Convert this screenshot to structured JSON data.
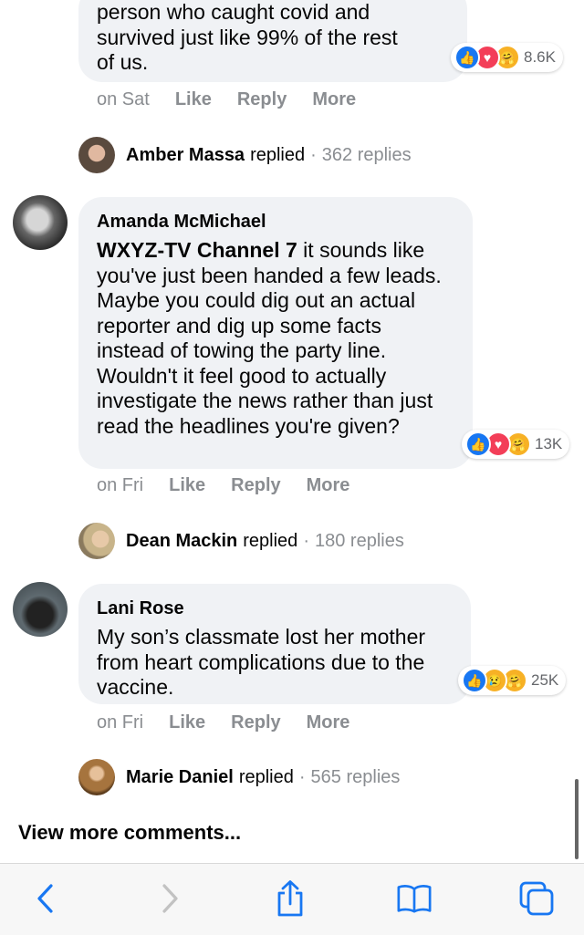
{
  "comments": [
    {
      "author": "",
      "text_lines": [
        "person who caught covid and",
        "survived just like 99% of the rest",
        "of us."
      ],
      "reaction_count": "8.6K",
      "time": "on Sat",
      "actions": [
        "Like",
        "Reply",
        "More"
      ],
      "replies": {
        "name": "Amber Massa",
        "verb": "replied",
        "count": "362 replies"
      }
    },
    {
      "author": "Amanda McMichael",
      "mention": "WXYZ-TV Channel 7",
      "text": " it sounds like you've just been handed a few leads. Maybe you could dig out an actual reporter and dig up some facts instead of towing the party line. Wouldn't it feel good to actually investigate the news rather than just read the headlines you're given?",
      "reaction_count": "13K",
      "time": "on Fri",
      "actions": [
        "Like",
        "Reply",
        "More"
      ],
      "replies": {
        "name": "Dean Mackin",
        "verb": "replied",
        "count": "180 replies"
      }
    },
    {
      "author": "Lani Rose",
      "text": "My son’s classmate lost her mother from heart complications due to the vaccine.",
      "reaction_count": "25K",
      "time": "on Fri",
      "actions": [
        "Like",
        "Reply",
        "More"
      ],
      "replies": {
        "name": "Marie Daniel",
        "verb": "replied",
        "count": "565 replies"
      }
    }
  ],
  "view_more": "View more comments...",
  "toolbar": [
    "back-icon",
    "forward-icon",
    "share-icon",
    "bookmarks-icon",
    "tabs-icon"
  ],
  "colors": {
    "accent": "#1877f2",
    "bubble": "#f0f2f5",
    "muted": "#8a8d91"
  }
}
